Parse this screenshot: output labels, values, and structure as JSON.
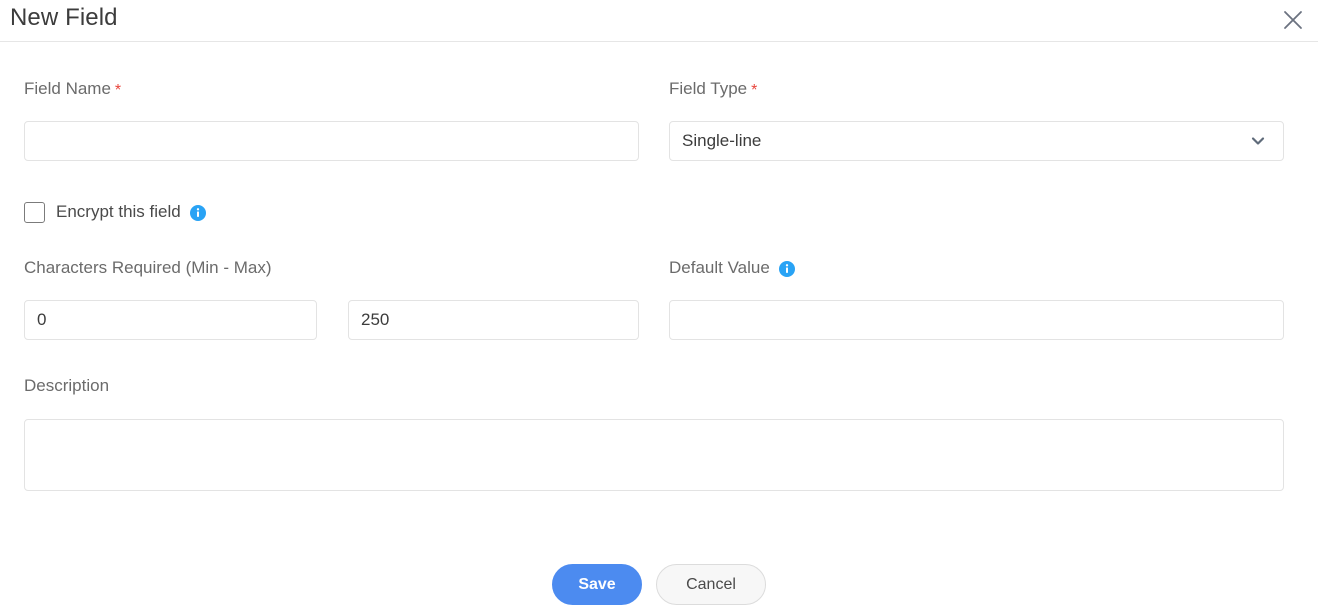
{
  "dialog": {
    "title": "New Field",
    "close_icon": "close-icon"
  },
  "colors": {
    "accent_blue": "#4c8bf0",
    "info_blue": "#29a3f5",
    "required_red": "#e8453c",
    "border": "#e3e3e3",
    "label_text": "#6b6b6b"
  },
  "fields": {
    "field_name": {
      "label": "Field Name",
      "required_marker": "*",
      "value": "",
      "placeholder": ""
    },
    "field_type": {
      "label": "Field Type",
      "required_marker": "*",
      "selected": "Single-line",
      "chevron_icon": "chevron-down-icon"
    },
    "encrypt": {
      "label": "Encrypt this field",
      "checked": false,
      "info_icon": "info-icon"
    },
    "characters_required": {
      "label": "Characters Required (Min - Max)",
      "min_value": "0",
      "max_value": "250",
      "min_placeholder": "",
      "max_placeholder": ""
    },
    "default_value": {
      "label": "Default Value",
      "value": "",
      "placeholder": "",
      "info_icon": "info-icon"
    },
    "description": {
      "label": "Description",
      "value": "",
      "placeholder": ""
    }
  },
  "footer": {
    "save_label": "Save",
    "cancel_label": "Cancel"
  }
}
